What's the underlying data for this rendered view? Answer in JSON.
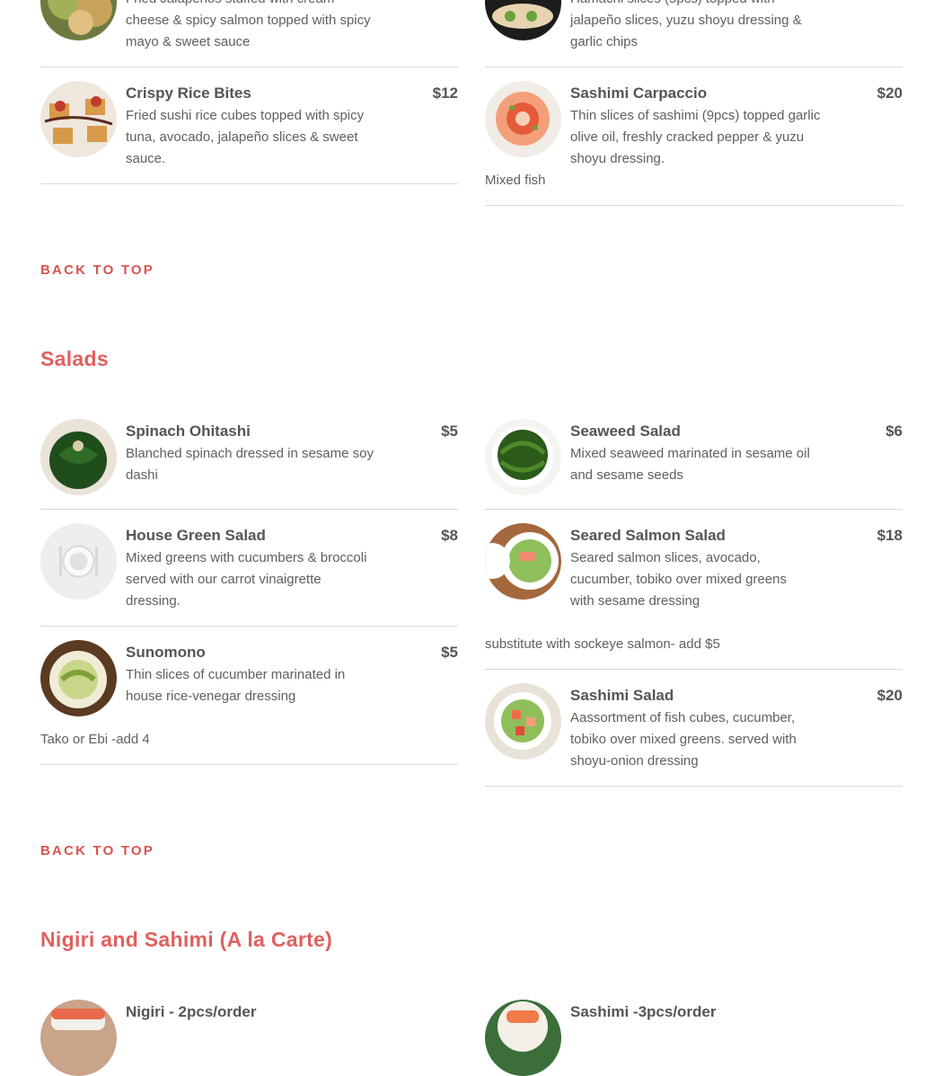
{
  "top_items": [
    {
      "name": "",
      "price": "",
      "desc": "Fried Jalapeños stuffed with cream cheese & spicy salmon topped with spicy mayo & sweet sauce"
    },
    {
      "name": "",
      "price": "",
      "desc": "Hamachi slices (5pcs) topped with jalapeño slices, yuzu shoyu  dressing & garlic chips"
    },
    {
      "name": "Crispy Rice Bites",
      "price": "$12",
      "desc": "Fried sushi rice cubes topped with spicy tuna, avocado, jalapeño slices & sweet sauce."
    },
    {
      "name": "Sashimi Carpaccio",
      "price": "$20",
      "desc": "Thin slices of sashimi (9pcs) topped garlic olive oil, freshly cracked pepper & yuzu shoyu dressing.",
      "note": "Mixed fish"
    }
  ],
  "back_to_top": "BACK TO TOP",
  "salads": {
    "title": "Salads",
    "items": [
      {
        "name": "Spinach Ohitashi",
        "price": "$5",
        "desc": "Blanched spinach dressed in sesame soy dashi"
      },
      {
        "name": "Seaweed Salad",
        "price": "$6",
        "desc": "Mixed seaweed marinated in sesame oil and sesame seeds"
      },
      {
        "name": "House Green Salad",
        "price": "$8",
        "desc": "Mixed greens with cucumbers & broccoli served with our carrot vinaigrette dressing."
      },
      {
        "name": "Seared Salmon Salad",
        "price": "$18",
        "desc": "Seared salmon slices, avocado, cucumber, tobiko over mixed greens with sesame dressing",
        "note": "substitute with sockeye salmon- add $5"
      },
      {
        "name": "Sunomono",
        "price": "$5",
        "desc": "Thin slices of cucumber marinated  in house rice-venegar dressing",
        "note": "Tako or Ebi -add 4"
      },
      {
        "name": "Sashimi Salad",
        "price": "$20",
        "desc": "Aassortment of  fish cubes, cucumber, tobiko over mixed greens. served with shoyu-onion dressing"
      }
    ]
  },
  "nigiri": {
    "title": "Nigiri and Sahimi (A la Carte)",
    "items": [
      {
        "name": "Nigiri - 2pcs/order"
      },
      {
        "name": "Sashimi -3pcs/order"
      }
    ]
  },
  "icons": {
    "placeholder": "plate-placeholder-icon"
  },
  "colors": {
    "accent": "#e06060",
    "link": "#d9534f"
  }
}
